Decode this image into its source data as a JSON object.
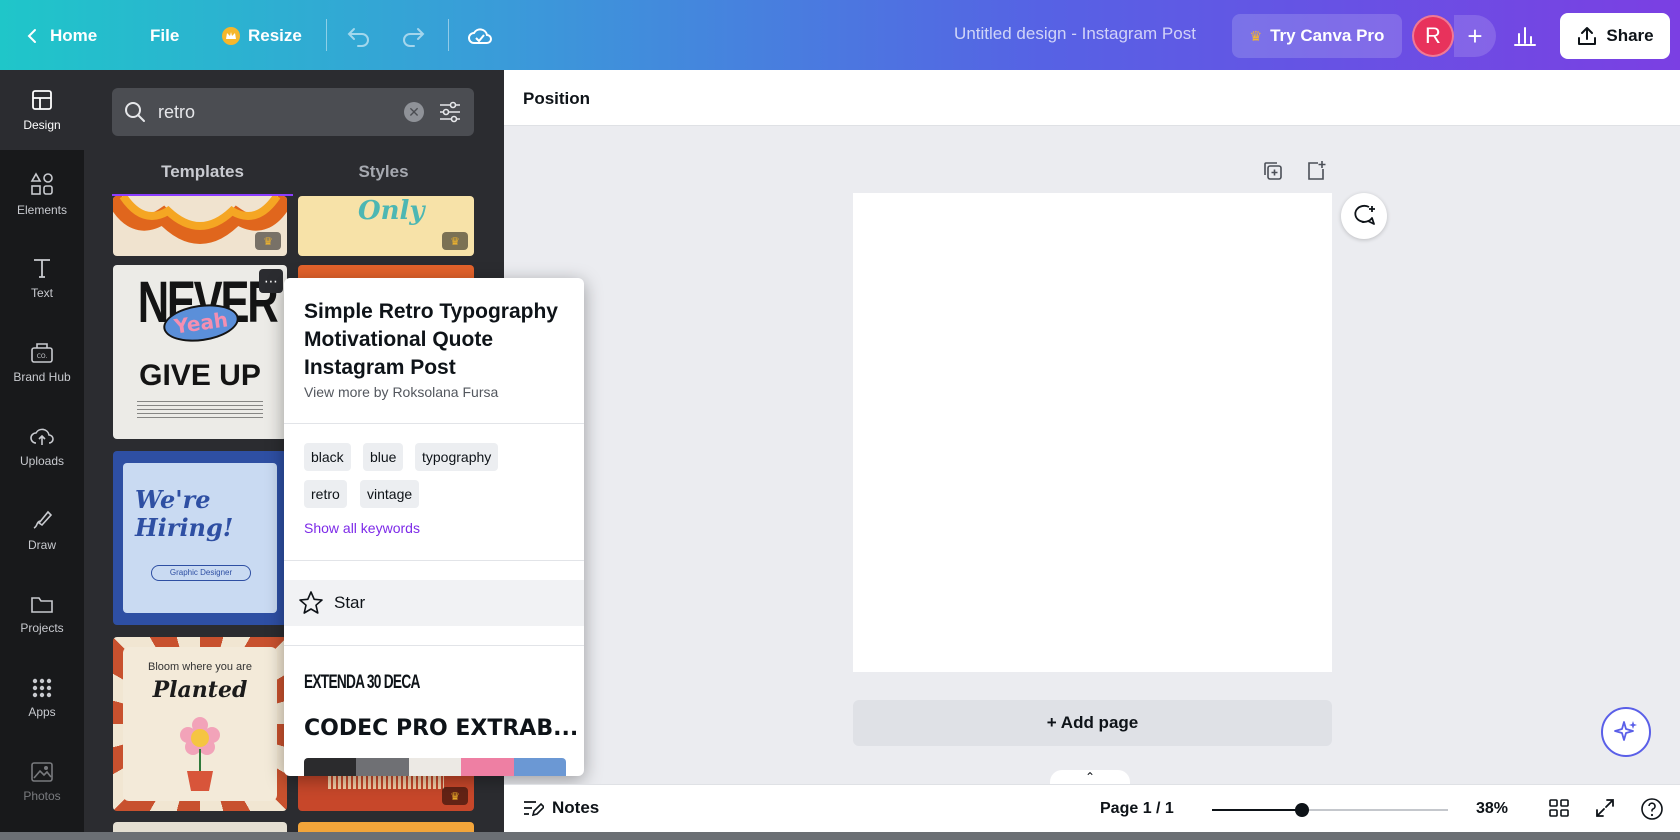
{
  "topbar": {
    "home_label": "Home",
    "file_label": "File",
    "resize_label": "Resize",
    "doc_title": "Untitled design - Instagram Post",
    "pro_label": "Try Canva Pro",
    "avatar_initial": "R",
    "share_label": "Share",
    "gradient": [
      "#1fc6c9",
      "#5662e4",
      "#7b3fe3"
    ]
  },
  "rail": {
    "items": [
      {
        "label": "Design",
        "icon": "layout-icon",
        "active": true
      },
      {
        "label": "Elements",
        "icon": "shapes-icon"
      },
      {
        "label": "Text",
        "icon": "text-icon"
      },
      {
        "label": "Brand Hub",
        "icon": "brand-icon"
      },
      {
        "label": "Uploads",
        "icon": "cloud-upload-icon"
      },
      {
        "label": "Draw",
        "icon": "pen-icon"
      },
      {
        "label": "Projects",
        "icon": "folder-icon"
      },
      {
        "label": "Apps",
        "icon": "apps-grid-icon"
      },
      {
        "label": "Photos",
        "icon": "image-icon"
      }
    ]
  },
  "panel": {
    "search_value": "retro",
    "tabs": [
      "Templates",
      "Styles"
    ],
    "active_tab": "Templates",
    "thumbs": {
      "never_line1": "NEVER",
      "never_sticker": "Yeah",
      "never_line2": "GIVE UP",
      "hiring_line1": "We're",
      "hiring_line2": "Hiring!",
      "hiring_role": "Graphic Designer",
      "bloom_line1": "Bloom where you are",
      "bloom_line2": "Planted",
      "only_text": "Only"
    }
  },
  "popover": {
    "title": "Simple Retro Typography Motivational Quote Instagram Post",
    "byline": "View more by Roksolana Fursa",
    "tags": [
      "black",
      "blue",
      "typography",
      "retro",
      "vintage"
    ],
    "show_keywords": "Show all keywords",
    "star_label": "Star",
    "font_1": "EXTENDA 30 DECA",
    "font_2": "CODEC PRO EXTRAB...",
    "palette": [
      "#2b2b2d",
      "#6f7074",
      "#ece9e4",
      "#ee7fa3",
      "#6b98d4"
    ]
  },
  "editor": {
    "context_label": "Position",
    "add_page_label": "+ Add page"
  },
  "bottombar": {
    "notes_label": "Notes",
    "page_indicator": "Page 1 / 1",
    "zoom_label": "38%",
    "zoom_fraction": 0.38
  }
}
